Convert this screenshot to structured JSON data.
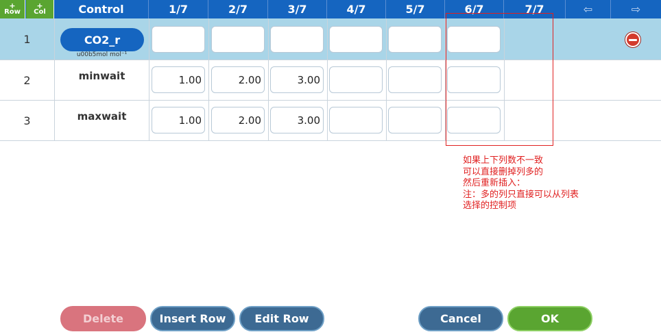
{
  "header": {
    "add_row": {
      "plus": "+",
      "label": "Row"
    },
    "add_col": {
      "plus": "+",
      "label": "Col"
    },
    "control": "Control",
    "columns": [
      "1/7",
      "2/7",
      "3/7",
      "4/7",
      "5/7",
      "6/7",
      "7/7"
    ],
    "prev_arrow": "⇦",
    "next_arrow": "⇨"
  },
  "rows": [
    {
      "num": "1",
      "control": "CO2_r",
      "control_sub": "u00b5mol mol⁻¹",
      "values": [
        "",
        "",
        "",
        "",
        "",
        ""
      ]
    },
    {
      "num": "2",
      "control": "minwait",
      "values": [
        "1.00",
        "2.00",
        "3.00",
        "",
        "",
        ""
      ]
    },
    {
      "num": "3",
      "control": "maxwait",
      "values": [
        "1.00",
        "2.00",
        "3.00",
        "",
        "",
        ""
      ]
    }
  ],
  "annotation": {
    "lines": [
      "如果上下列数不一致",
      "可以直接删掉列多的",
      "然后重新插入：",
      "注：多的列只直接可以从列表",
      "选择的控制项"
    ],
    "color": "#e02020"
  },
  "buttons": {
    "delete": "Delete",
    "insert_row": "Insert Row",
    "edit_row": "Edit Row",
    "cancel": "Cancel",
    "ok": "OK"
  },
  "colors": {
    "header": "#1565c0",
    "selected_row": "#a9d5e8",
    "ok": "#5aa531",
    "delete": "#d9747e"
  }
}
